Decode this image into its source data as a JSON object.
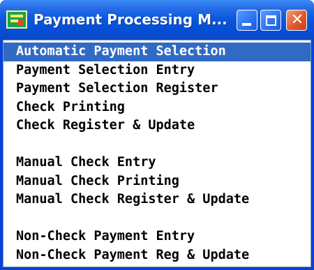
{
  "window": {
    "title": "Payment Processing M..."
  },
  "icons": {
    "app": "app-window-icon",
    "minimize": "minimize-icon",
    "maximize": "maximize-icon",
    "close": "close-icon"
  },
  "colors": {
    "titlebar": "#0a5ae0",
    "selection": "#316ac5",
    "close_button": "#e05a2a"
  },
  "menu": {
    "items": [
      {
        "label": "Automatic Payment Selection",
        "selected": true
      },
      {
        "label": "Payment Selection Entry",
        "selected": false
      },
      {
        "label": "Payment Selection Register",
        "selected": false
      },
      {
        "label": "Check Printing",
        "selected": false
      },
      {
        "label": "Check Register & Update",
        "selected": false
      },
      {
        "label": "Manual Check Entry",
        "selected": false
      },
      {
        "label": "Manual Check Printing",
        "selected": false
      },
      {
        "label": "Manual Check Register & Update",
        "selected": false
      },
      {
        "label": "Non-Check Payment Entry",
        "selected": false
      },
      {
        "label": "Non-Check Payment Reg & Update",
        "selected": false
      }
    ]
  }
}
